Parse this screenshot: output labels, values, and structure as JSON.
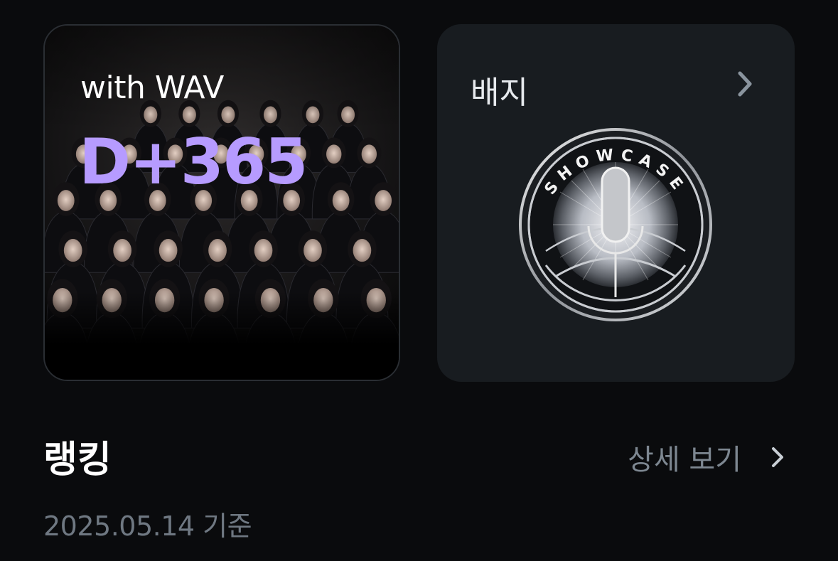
{
  "dday_card": {
    "subtitle": "with WAV",
    "value": "D+365",
    "accent_color": "#b69bff"
  },
  "badge_card": {
    "title": "배지",
    "badge_name": "SHOWCASE",
    "chevron_icon": "chevron-right-icon"
  },
  "ranking": {
    "title": "랭킹",
    "more_label": "상세 보기",
    "date_label": "2025.05.14 기준"
  }
}
